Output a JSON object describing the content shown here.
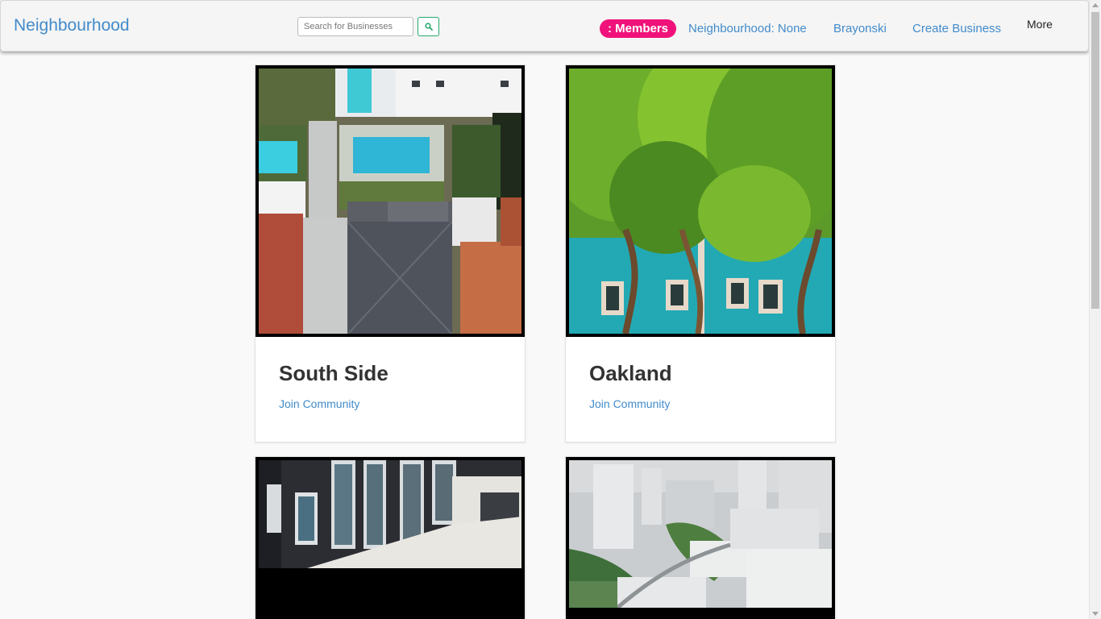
{
  "navbar": {
    "brand": "Neighbourhood",
    "search_placeholder": "Search for Businesses",
    "members_label": ": Members",
    "links": [
      "Neighbourhood: None",
      "Brayonski",
      "Create Business"
    ],
    "more_label": "More"
  },
  "communities": [
    {
      "name": "South Side",
      "action": "Join Community",
      "image": "aerial-rooftops-pools"
    },
    {
      "name": "Oakland",
      "action": "Join Community",
      "image": "trees-over-teal-building"
    },
    {
      "name": "",
      "action": "",
      "image": "dark-brick-building-windows"
    },
    {
      "name": "",
      "action": "",
      "image": "aerial-city-highrises"
    }
  ],
  "colors": {
    "link": "#428bca",
    "members_badge": "#f0127a",
    "search_button_border": "#26a96c",
    "navbar_bg": "#f5f5f5",
    "page_bg": "#f9f9f9"
  }
}
